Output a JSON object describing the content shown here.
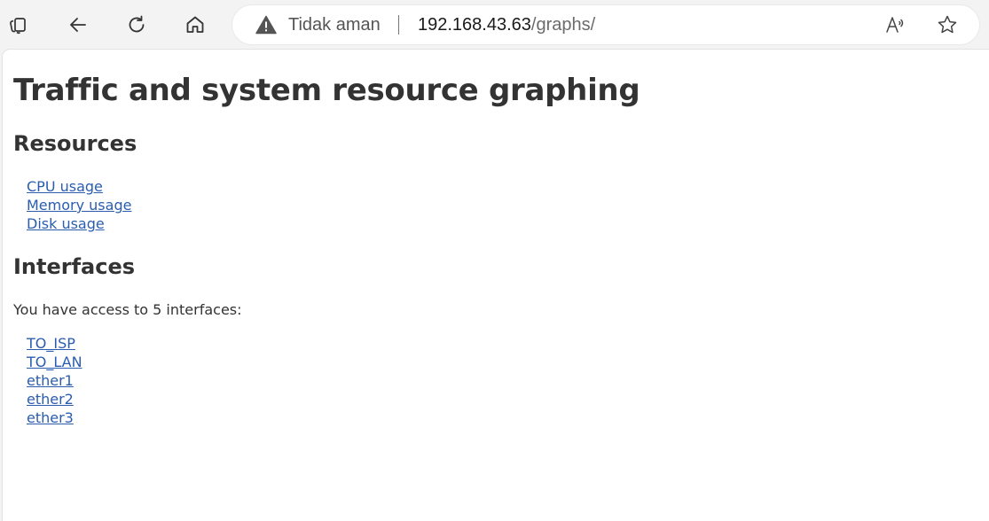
{
  "browser": {
    "security_label": "Tidak aman",
    "url_host": "192.168.43.63",
    "url_path": "/graphs/"
  },
  "page": {
    "title": "Traffic and system resource graphing",
    "resources": {
      "heading": "Resources",
      "links": [
        "CPU usage",
        "Memory usage",
        "Disk usage"
      ]
    },
    "interfaces": {
      "heading": "Interfaces",
      "intro": "You have access to 5 interfaces:",
      "links": [
        "TO_ISP",
        "TO_LAN",
        "ether1",
        "ether2",
        "ether3"
      ]
    }
  }
}
